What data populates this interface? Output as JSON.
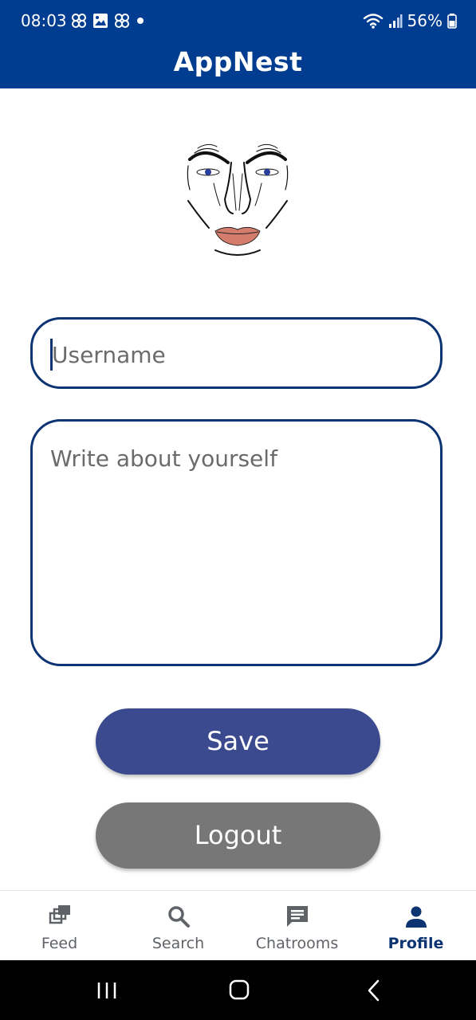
{
  "status_bar": {
    "time": "08:03",
    "battery": "56%",
    "icons": [
      "pinwheel-icon",
      "image-icon",
      "pinwheel-icon",
      "dot-icon",
      "wifi-icon",
      "signal-icon",
      "battery-icon"
    ]
  },
  "app_bar": {
    "title": "AppNest"
  },
  "profile": {
    "avatar": "face-avatar",
    "username_placeholder": "Username",
    "bio_placeholder": "Write about yourself"
  },
  "actions": {
    "save_label": "Save",
    "logout_label": "Logout"
  },
  "bottom_nav": {
    "items": [
      {
        "label": "Feed",
        "icon": "feed-icon",
        "active": false
      },
      {
        "label": "Search",
        "icon": "search-icon",
        "active": false
      },
      {
        "label": "Chatrooms",
        "icon": "chat-icon",
        "active": false
      },
      {
        "label": "Profile",
        "icon": "person-icon",
        "active": true
      }
    ]
  },
  "system_nav": [
    "recents-icon",
    "home-icon",
    "back-icon"
  ],
  "colors": {
    "primary": "#003C8F",
    "border": "#0D3472",
    "save": "#3B4A8E",
    "logout": "#777777"
  }
}
